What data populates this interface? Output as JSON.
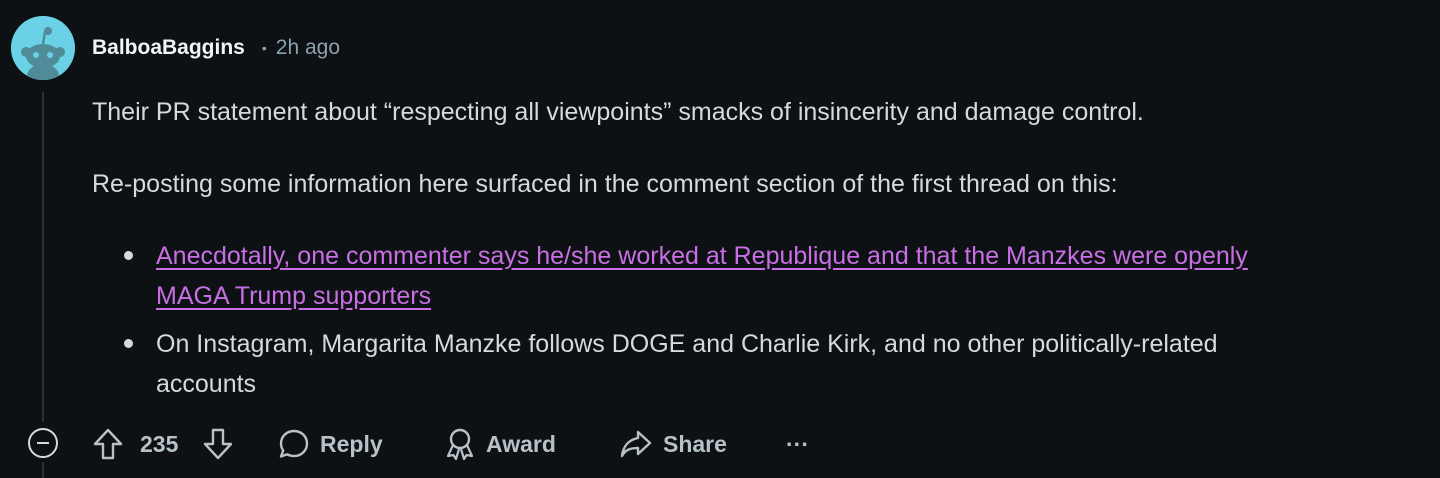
{
  "comment": {
    "author": "BalboaBaggins",
    "separator": "•",
    "time": "2h ago",
    "paragraphs": [
      "Their PR statement about “respecting all viewpoints” smacks of insincerity and damage control.",
      "Re-posting some information here surfaced in the comment section of the first thread on this:"
    ],
    "bullets": [
      {
        "line1": "Anecdotally, one commenter says he/she worked at Republique and that the Manzkes were openly",
        "line2": "MAGA Trump supporters",
        "is_link": true
      },
      {
        "line1": "On Instagram, Margarita Manzke follows DOGE and Charlie Kirk, and no other politically-related",
        "line2": "accounts",
        "is_link": false
      }
    ]
  },
  "actions": {
    "score": "235",
    "reply_label": "Reply",
    "award_label": "Award",
    "share_label": "Share",
    "more_label": "···"
  },
  "icons": {
    "collapse": "minus-circle-icon",
    "upvote": "arrow-up-icon",
    "downvote": "arrow-down-icon",
    "reply": "speech-bubble-icon",
    "award": "award-ribbon-icon",
    "share": "share-arrow-icon",
    "more": "ellipsis-icon"
  },
  "colors": {
    "background": "#0e1113",
    "text": "#d7dadc",
    "muted": "#8ba2ad",
    "link": "#c86fe6",
    "avatar_bg": "#6ad1e6"
  }
}
